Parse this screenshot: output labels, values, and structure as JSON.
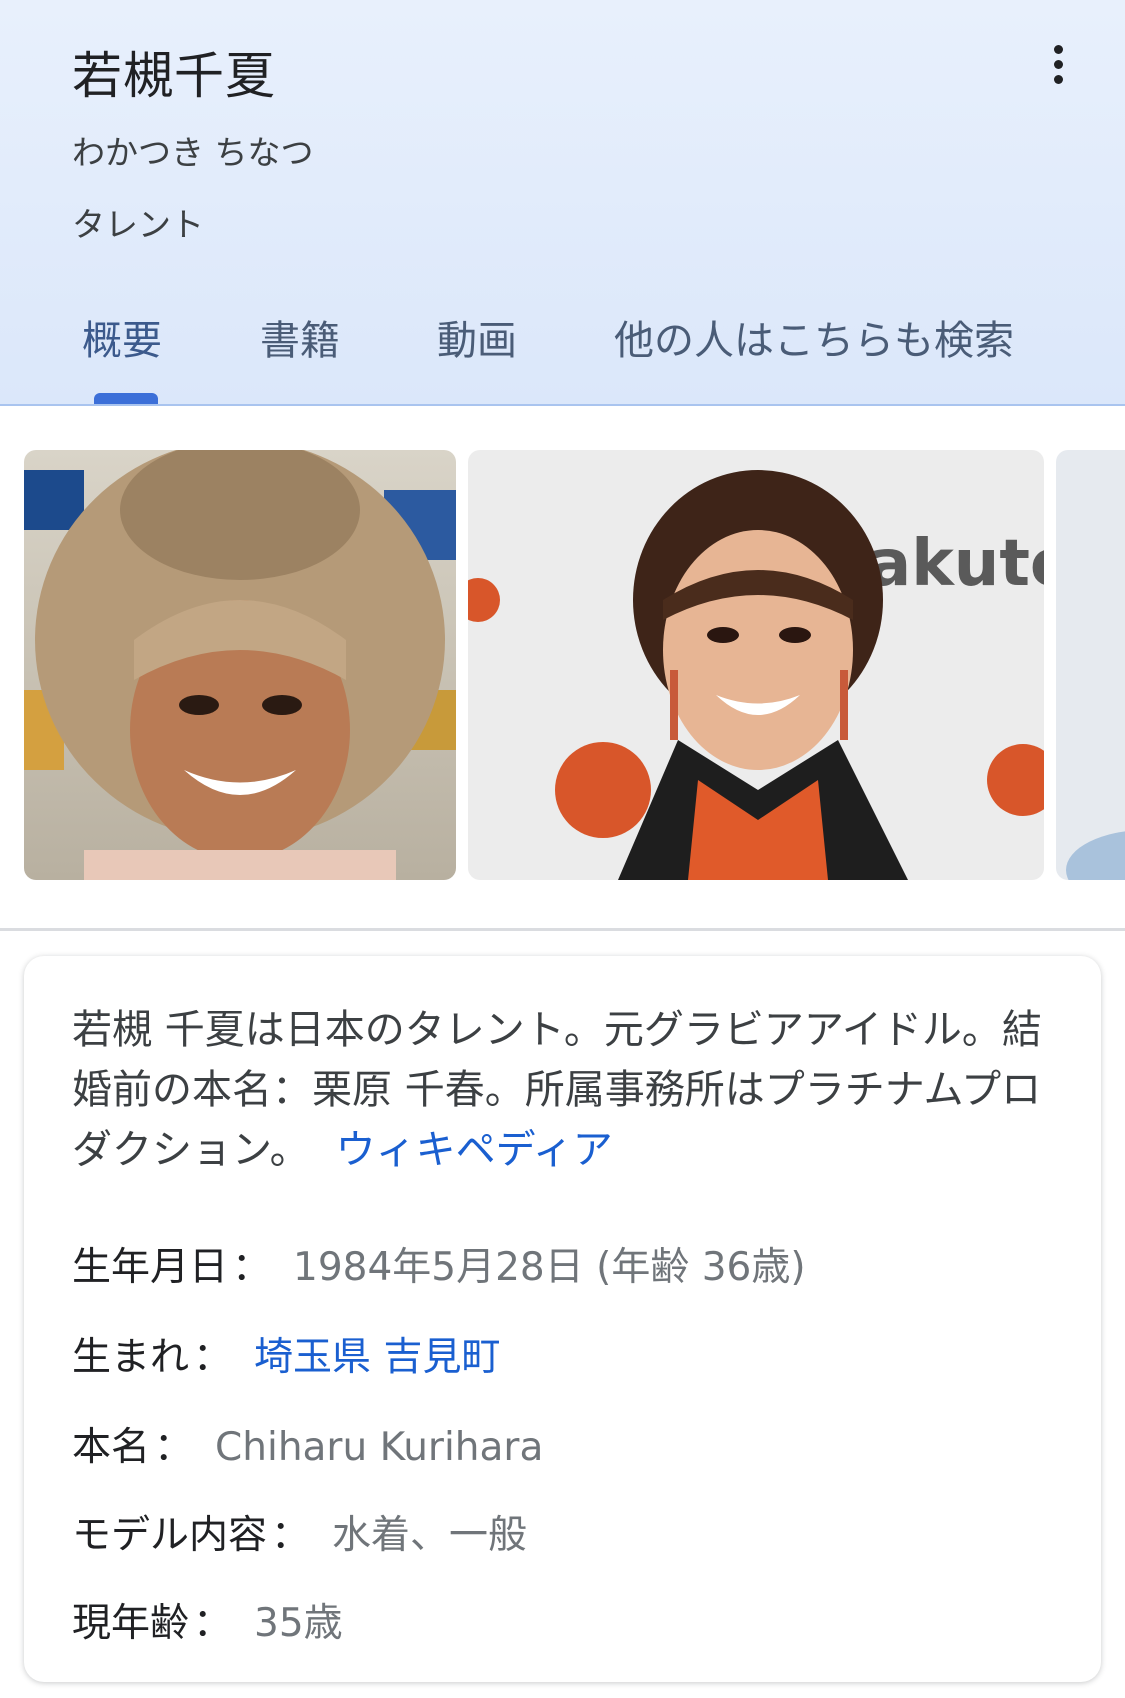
{
  "header": {
    "title": "若槻千夏",
    "reading": "わかつき ちなつ",
    "category": "タレント",
    "menu_icon": "more-vert-icon",
    "tabs": [
      {
        "label": "概要",
        "active": true
      },
      {
        "label": "書籍",
        "active": false
      },
      {
        "label": "動画",
        "active": false
      },
      {
        "label": "他の人はこちらも検索",
        "active": false
      }
    ],
    "accent_color": "#3c6fd8"
  },
  "images": [
    {
      "name": "profile-photo-1"
    },
    {
      "name": "profile-photo-2"
    },
    {
      "name": "profile-photo-3"
    }
  ],
  "card": {
    "description": "若槻 千夏は日本のタレント。元グラビアアイドル。結婚前の本名：栗原 千春。所属事務所はプラチナムプロダクション。",
    "source_link": "ウィキペディア",
    "facts": [
      {
        "label": "生年月日",
        "value": "1984年5月28日 (年齢 36歳)"
      },
      {
        "label": "生まれ",
        "value_link_1": "埼玉県",
        "value_link_2": "吉見町"
      },
      {
        "label": "本名",
        "value": "Chiharu Kurihara"
      },
      {
        "label": "モデル内容",
        "value": "水着、一般"
      },
      {
        "label": "現年齢",
        "value": "35歳"
      }
    ],
    "separator": "："
  },
  "colors": {
    "link": "#1a5fd0",
    "header_bg": "#e2ecfb",
    "muted_text": "#70757a"
  }
}
